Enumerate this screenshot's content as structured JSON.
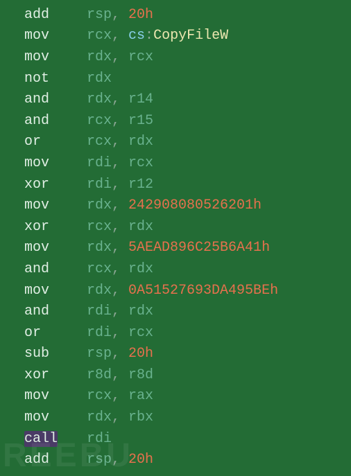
{
  "asm": {
    "lines": [
      {
        "instruction": "add",
        "highlight": false,
        "ops": [
          {
            "t": "reg",
            "v": "rsp"
          },
          {
            "t": "punct",
            "v": ", "
          },
          {
            "t": "num",
            "v": "20h"
          }
        ]
      },
      {
        "instruction": "mov",
        "highlight": false,
        "ops": [
          {
            "t": "reg",
            "v": "rcx"
          },
          {
            "t": "punct",
            "v": ", "
          },
          {
            "t": "seg",
            "v": "cs"
          },
          {
            "t": "punct",
            "v": ":"
          },
          {
            "t": "sym",
            "v": "CopyFileW"
          }
        ]
      },
      {
        "instruction": "mov",
        "highlight": false,
        "ops": [
          {
            "t": "reg",
            "v": "rdx"
          },
          {
            "t": "punct",
            "v": ", "
          },
          {
            "t": "reg",
            "v": "rcx"
          }
        ]
      },
      {
        "instruction": "not",
        "highlight": false,
        "ops": [
          {
            "t": "reg",
            "v": "rdx"
          }
        ]
      },
      {
        "instruction": "and",
        "highlight": false,
        "ops": [
          {
            "t": "reg",
            "v": "rdx"
          },
          {
            "t": "punct",
            "v": ", "
          },
          {
            "t": "reg",
            "v": "r14"
          }
        ]
      },
      {
        "instruction": "and",
        "highlight": false,
        "ops": [
          {
            "t": "reg",
            "v": "rcx"
          },
          {
            "t": "punct",
            "v": ", "
          },
          {
            "t": "reg",
            "v": "r15"
          }
        ]
      },
      {
        "instruction": "or",
        "highlight": false,
        "ops": [
          {
            "t": "reg",
            "v": "rcx"
          },
          {
            "t": "punct",
            "v": ", "
          },
          {
            "t": "reg",
            "v": "rdx"
          }
        ]
      },
      {
        "instruction": "mov",
        "highlight": false,
        "ops": [
          {
            "t": "reg",
            "v": "rdi"
          },
          {
            "t": "punct",
            "v": ", "
          },
          {
            "t": "reg",
            "v": "rcx"
          }
        ]
      },
      {
        "instruction": "xor",
        "highlight": false,
        "ops": [
          {
            "t": "reg",
            "v": "rdi"
          },
          {
            "t": "punct",
            "v": ", "
          },
          {
            "t": "reg",
            "v": "r12"
          }
        ]
      },
      {
        "instruction": "mov",
        "highlight": false,
        "ops": [
          {
            "t": "reg",
            "v": "rdx"
          },
          {
            "t": "punct",
            "v": ", "
          },
          {
            "t": "num",
            "v": "242908080526201h"
          }
        ]
      },
      {
        "instruction": "xor",
        "highlight": false,
        "ops": [
          {
            "t": "reg",
            "v": "rcx"
          },
          {
            "t": "punct",
            "v": ", "
          },
          {
            "t": "reg",
            "v": "rdx"
          }
        ]
      },
      {
        "instruction": "mov",
        "highlight": false,
        "ops": [
          {
            "t": "reg",
            "v": "rdx"
          },
          {
            "t": "punct",
            "v": ", "
          },
          {
            "t": "num",
            "v": "5AEAD896C25B6A41h"
          }
        ]
      },
      {
        "instruction": "and",
        "highlight": false,
        "ops": [
          {
            "t": "reg",
            "v": "rcx"
          },
          {
            "t": "punct",
            "v": ", "
          },
          {
            "t": "reg",
            "v": "rdx"
          }
        ]
      },
      {
        "instruction": "mov",
        "highlight": false,
        "ops": [
          {
            "t": "reg",
            "v": "rdx"
          },
          {
            "t": "punct",
            "v": ", "
          },
          {
            "t": "num",
            "v": "0A51527693DA495BEh"
          }
        ]
      },
      {
        "instruction": "and",
        "highlight": false,
        "ops": [
          {
            "t": "reg",
            "v": "rdi"
          },
          {
            "t": "punct",
            "v": ", "
          },
          {
            "t": "reg",
            "v": "rdx"
          }
        ]
      },
      {
        "instruction": "or",
        "highlight": false,
        "ops": [
          {
            "t": "reg",
            "v": "rdi"
          },
          {
            "t": "punct",
            "v": ", "
          },
          {
            "t": "reg",
            "v": "rcx"
          }
        ]
      },
      {
        "instruction": "sub",
        "highlight": false,
        "ops": [
          {
            "t": "reg",
            "v": "rsp"
          },
          {
            "t": "punct",
            "v": ", "
          },
          {
            "t": "num",
            "v": "20h"
          }
        ]
      },
      {
        "instruction": "xor",
        "highlight": false,
        "ops": [
          {
            "t": "reg",
            "v": "r8d"
          },
          {
            "t": "punct",
            "v": ", "
          },
          {
            "t": "reg",
            "v": "r8d"
          }
        ]
      },
      {
        "instruction": "mov",
        "highlight": false,
        "ops": [
          {
            "t": "reg",
            "v": "rcx"
          },
          {
            "t": "punct",
            "v": ", "
          },
          {
            "t": "reg",
            "v": "rax"
          }
        ]
      },
      {
        "instruction": "mov",
        "highlight": false,
        "ops": [
          {
            "t": "reg",
            "v": "rdx"
          },
          {
            "t": "punct",
            "v": ", "
          },
          {
            "t": "reg",
            "v": "rbx"
          }
        ]
      },
      {
        "instruction": "call",
        "highlight": true,
        "ops": [
          {
            "t": "reg",
            "v": "rdi"
          }
        ]
      },
      {
        "instruction": "add",
        "highlight": false,
        "ops": [
          {
            "t": "reg",
            "v": "rsp"
          },
          {
            "t": "punct",
            "v": ", "
          },
          {
            "t": "num",
            "v": "20h"
          }
        ]
      }
    ]
  },
  "watermark": "REEBU"
}
